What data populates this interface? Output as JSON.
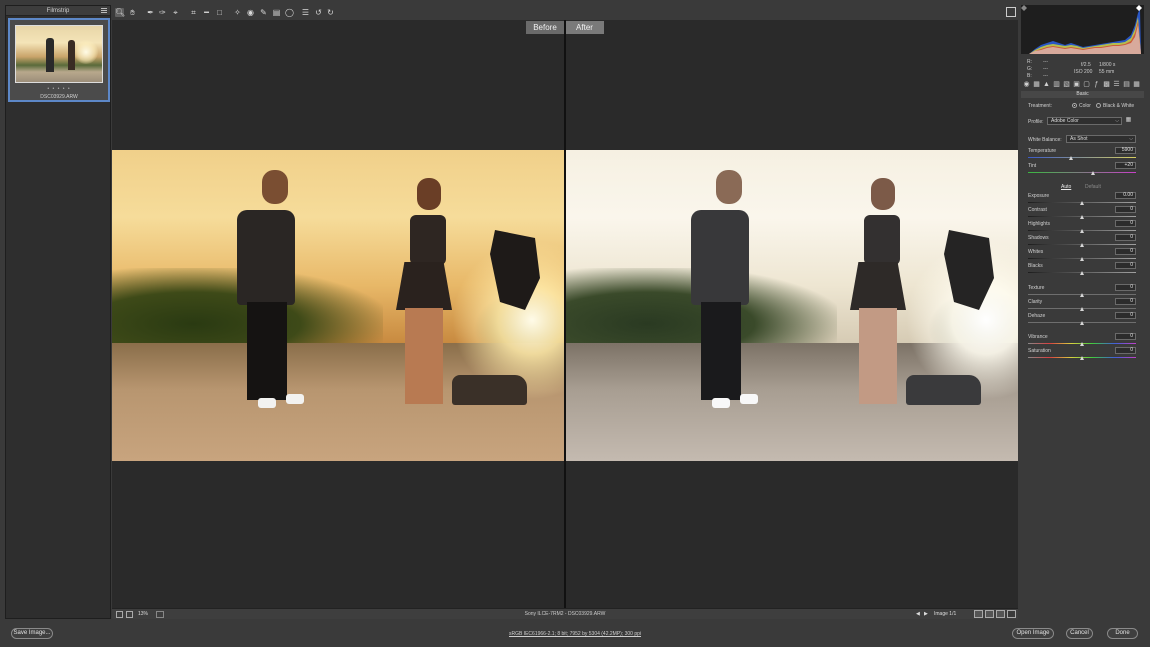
{
  "filmstrip": {
    "title": "Filmstrip",
    "rating_dots": "• • • • •",
    "thumbnail_name": "DSC03929.ARW"
  },
  "toolbar": {
    "tools": [
      "zoom-icon",
      "hand-icon",
      "white-balance-icon",
      "color-sampler-icon",
      "targeted-adjustment-icon",
      "crop-icon",
      "straighten-icon",
      "transform-icon",
      "spot-removal-icon",
      "red-eye-icon",
      "adjustment-brush-icon",
      "graduated-filter-icon",
      "radial-filter-icon",
      "preferences-icon",
      "rotate-left-icon",
      "rotate-right-icon"
    ]
  },
  "preview": {
    "before_label": "Before",
    "after_label": "After"
  },
  "statusbar": {
    "zoom": "13%",
    "camera_info": "Sony ILCE-7RM2 - DSC03929.ARW",
    "image_count": "Image 1/1"
  },
  "exif": {
    "r_label": "R:",
    "g_label": "G:",
    "b_label": "B:",
    "r_val": "---",
    "g_val": "---",
    "b_val": "---",
    "aperture": "f/2.5",
    "shutter": "1/800 s",
    "iso": "ISO 200",
    "focal": "55 mm"
  },
  "basic": {
    "title": "Basic",
    "treatment_label": "Treatment:",
    "color_option": "Color",
    "bw_option": "Black & White",
    "profile_label": "Profile:",
    "profile_value": "Adobe Color",
    "white_balance_label": "White Balance:",
    "white_balance_value": "As Shot",
    "temperature_label": "Temperature",
    "temperature_value": "5900",
    "tint_label": "Tint",
    "tint_value": "+20",
    "auto_label": "Auto",
    "default_label": "Default",
    "sliders": [
      {
        "label": "Exposure",
        "value": "0.00",
        "pos": 0.5
      },
      {
        "label": "Contrast",
        "value": "0",
        "pos": 0.5
      },
      {
        "label": "Highlights",
        "value": "0",
        "pos": 0.5
      },
      {
        "label": "Shadows",
        "value": "0",
        "pos": 0.5
      },
      {
        "label": "Whites",
        "value": "0",
        "pos": 0.5
      },
      {
        "label": "Blacks",
        "value": "0",
        "pos": 0.5
      },
      {
        "label": "Texture",
        "value": "0",
        "pos": 0.5
      },
      {
        "label": "Clarity",
        "value": "0",
        "pos": 0.5
      },
      {
        "label": "Dehaze",
        "value": "0",
        "pos": 0.5
      },
      {
        "label": "Vibrance",
        "value": "0",
        "pos": 0.5
      },
      {
        "label": "Saturation",
        "value": "0",
        "pos": 0.5
      }
    ],
    "temperature_pos": 0.4,
    "tint_pos": 0.6
  },
  "bottom": {
    "save_image": "Save Image...",
    "workflow": "sRGB IEC61966-2.1; 8 bit; 7952 by 5304 (42.2MP); 300 ppi",
    "open_image": "Open Image",
    "cancel": "Cancel",
    "done": "Done"
  },
  "colors": {
    "accent": "#5d88c8",
    "panel_bg": "#3a3a3a",
    "preview_bg": "#2a2a2a"
  }
}
